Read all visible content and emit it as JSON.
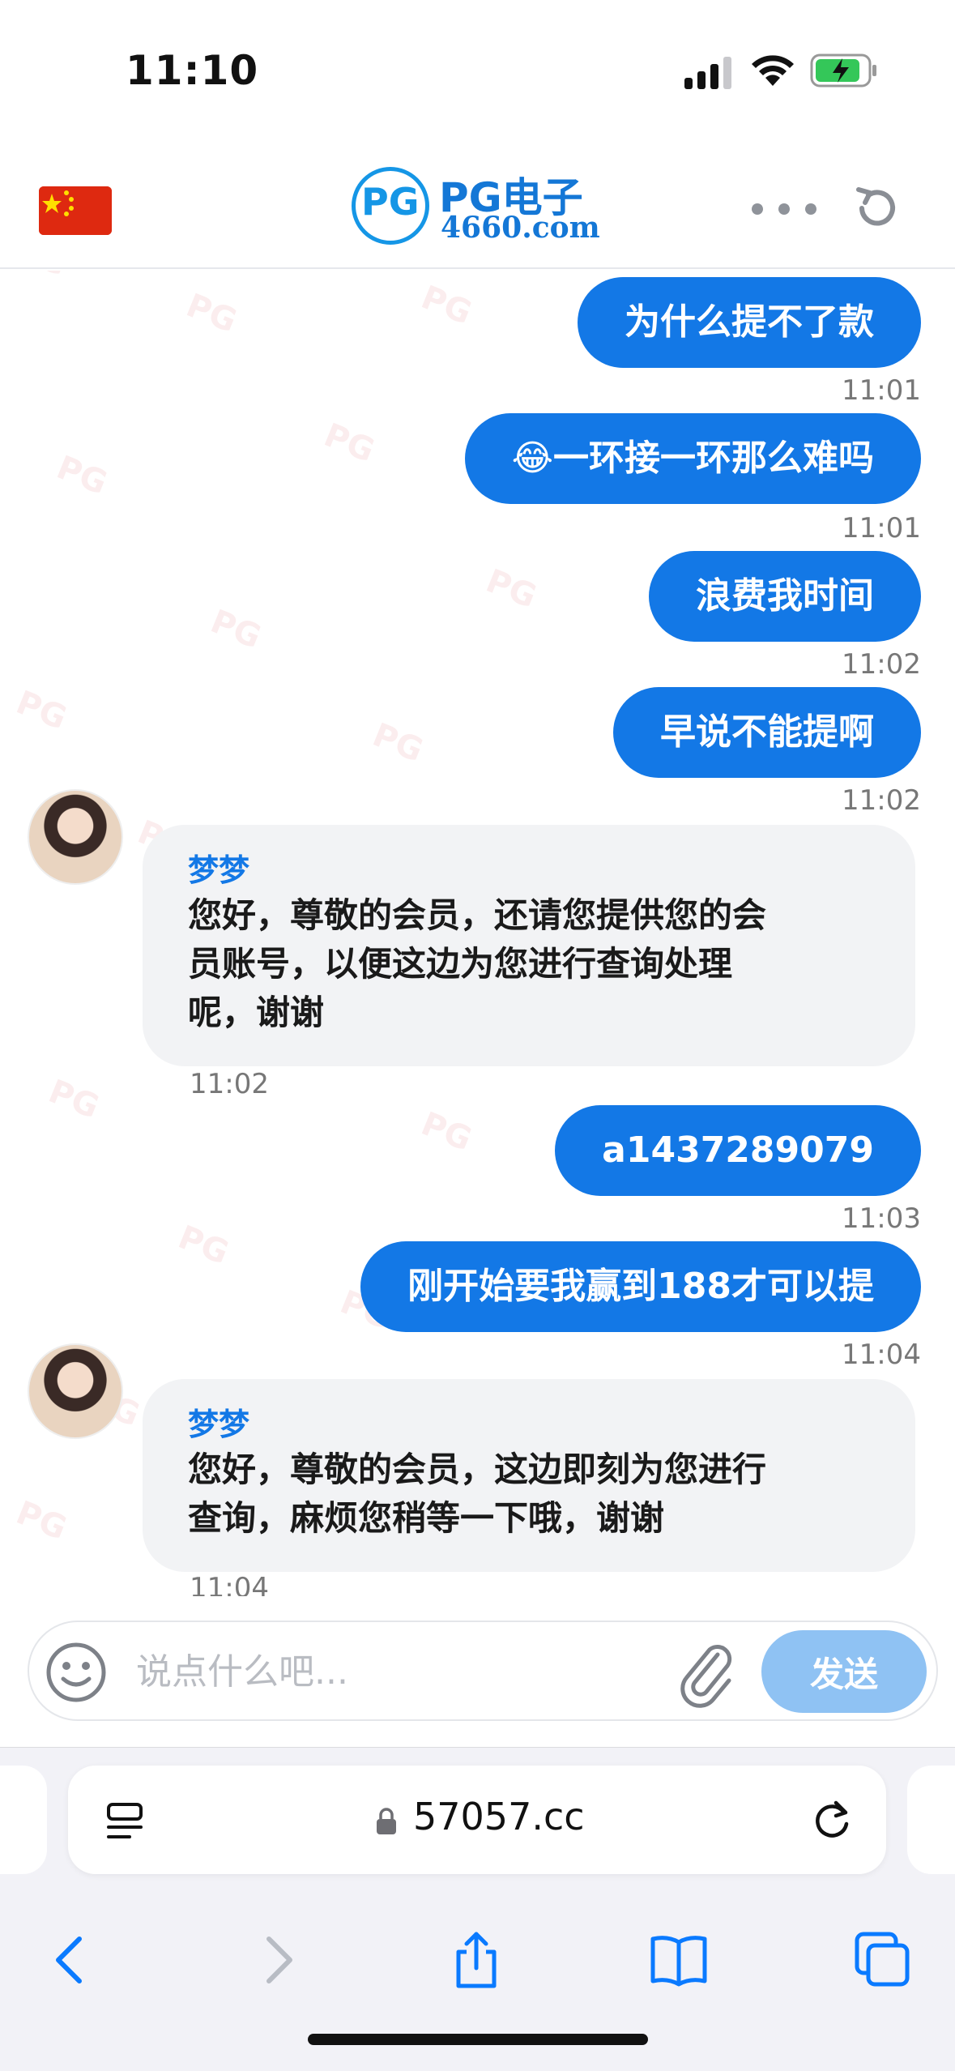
{
  "status_bar": {
    "time": "11:10"
  },
  "header": {
    "logo_pg": "PG",
    "logo_title": "PG电子",
    "logo_sub": "4660.com",
    "flag_icon": "china-flag-icon",
    "more_icon": "more-dots-icon",
    "refresh_icon": "refresh-icon"
  },
  "watermark_text": "PG",
  "messages": [
    {
      "type": "out",
      "text": "为什么提不了款",
      "time": "11:01"
    },
    {
      "type": "out",
      "text": "😂一环接一环那么难吗",
      "time": "11:01"
    },
    {
      "type": "out",
      "text": "浪费我时间",
      "time": "11:02"
    },
    {
      "type": "out",
      "text": "早说不能提啊",
      "time": "11:02"
    },
    {
      "type": "in",
      "sender": "梦梦",
      "lines": [
        "您好，尊敬的会员，还请您提供您的会",
        "员账号，以便这边为您进行查询处理",
        "呢，谢谢"
      ],
      "time": "11:02"
    },
    {
      "type": "out",
      "text": "a1437289079",
      "time": "11:03"
    },
    {
      "type": "out",
      "text": "刚开始要我赢到188才可以提",
      "time": "11:04"
    },
    {
      "type": "in",
      "sender": "梦梦",
      "lines": [
        "您好，尊敬的会员，这边即刻为您进行",
        "查询，麻烦您稍等一下哦，谢谢"
      ],
      "time": "11:04"
    }
  ],
  "input_bar": {
    "placeholder": "说点什么吧...",
    "value": "",
    "send_label": "发送"
  },
  "browser": {
    "url": "57057.cc"
  },
  "colors": {
    "accent": "#1378e6",
    "send_disabled": "#8fc2f3",
    "incoming_bubble": "#f2f3f5"
  }
}
